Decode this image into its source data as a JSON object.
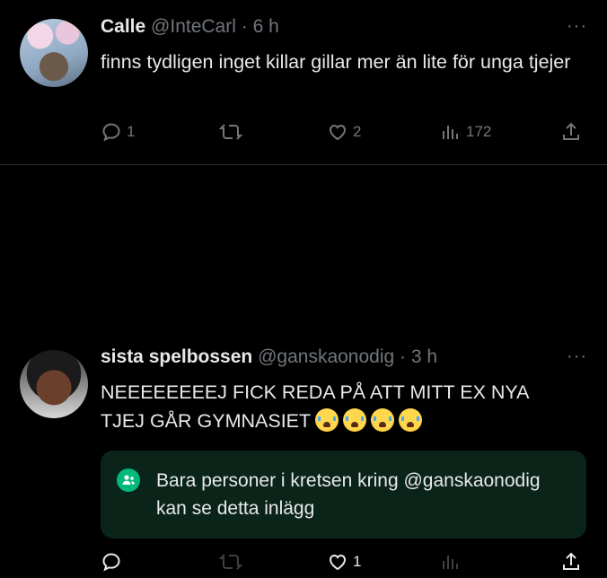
{
  "tweets": [
    {
      "name": "Calle",
      "handle": "@InteCarl",
      "separator": "·",
      "time": "6 h",
      "more": "···",
      "text": "finns tydligen inget killar gillar mer än lite för unga tjejer",
      "actions": {
        "replies": "1",
        "reposts": "",
        "likes": "2",
        "views": "172"
      }
    },
    {
      "name": "sista spelbossen",
      "handle": "@ganskaonodig",
      "separator": "·",
      "time": "3 h",
      "more": "···",
      "text_line1": "NEEEEEEEEJ FICK REDA PÅ ATT MITT EX NYA",
      "text_line2": "TJEJ GÅR GYMNASIET",
      "emoji_count": 4,
      "circle_notice": "Bara personer i kretsen kring @ganskaonodig kan se detta inlägg",
      "actions": {
        "replies": "",
        "reposts": "",
        "likes": "1",
        "views": ""
      }
    }
  ],
  "icons": [
    "reply-icon",
    "repost-icon",
    "like-icon",
    "views-icon",
    "share-icon",
    "circle-people-icon",
    "loudly-crying-emoji"
  ],
  "colors": {
    "background": "#000000",
    "text": "#e7e9ea",
    "muted": "#71767b",
    "circle_green": "#00ba7c",
    "circle_bg": "#0b2419"
  }
}
